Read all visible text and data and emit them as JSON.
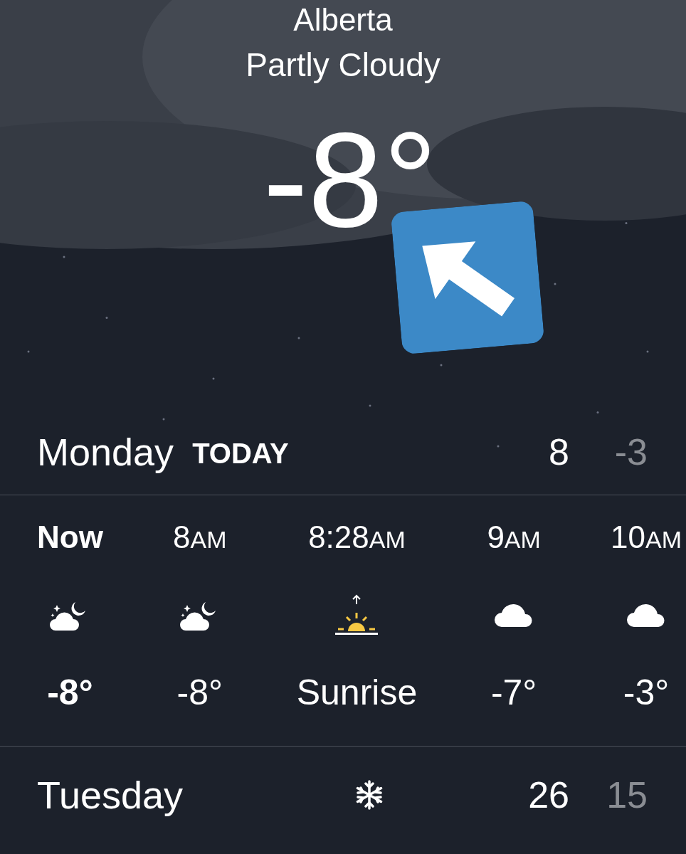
{
  "location": {
    "city": "Alberta",
    "condition": "Partly Cloudy",
    "temperature": "-8°"
  },
  "today": {
    "day": "Monday",
    "label": "TODAY",
    "high": "8",
    "low": "-3"
  },
  "hourly": [
    {
      "time": "Now",
      "current": true,
      "kind": "moon-cloud",
      "value": "-8°"
    },
    {
      "time": "8",
      "suffix": "AM",
      "current": false,
      "kind": "moon-cloud",
      "value": "-8°"
    },
    {
      "time": "8:28",
      "suffix": "AM",
      "current": false,
      "kind": "sunrise",
      "value": "Sunrise"
    },
    {
      "time": "9",
      "suffix": "AM",
      "current": false,
      "kind": "cloud",
      "value": "-7°"
    },
    {
      "time": "10",
      "suffix": "AM",
      "current": false,
      "kind": "cloud",
      "value": "-3°"
    }
  ],
  "days": [
    {
      "day": "Tuesday",
      "kind": "snow",
      "high": "26",
      "low": "15"
    }
  ]
}
